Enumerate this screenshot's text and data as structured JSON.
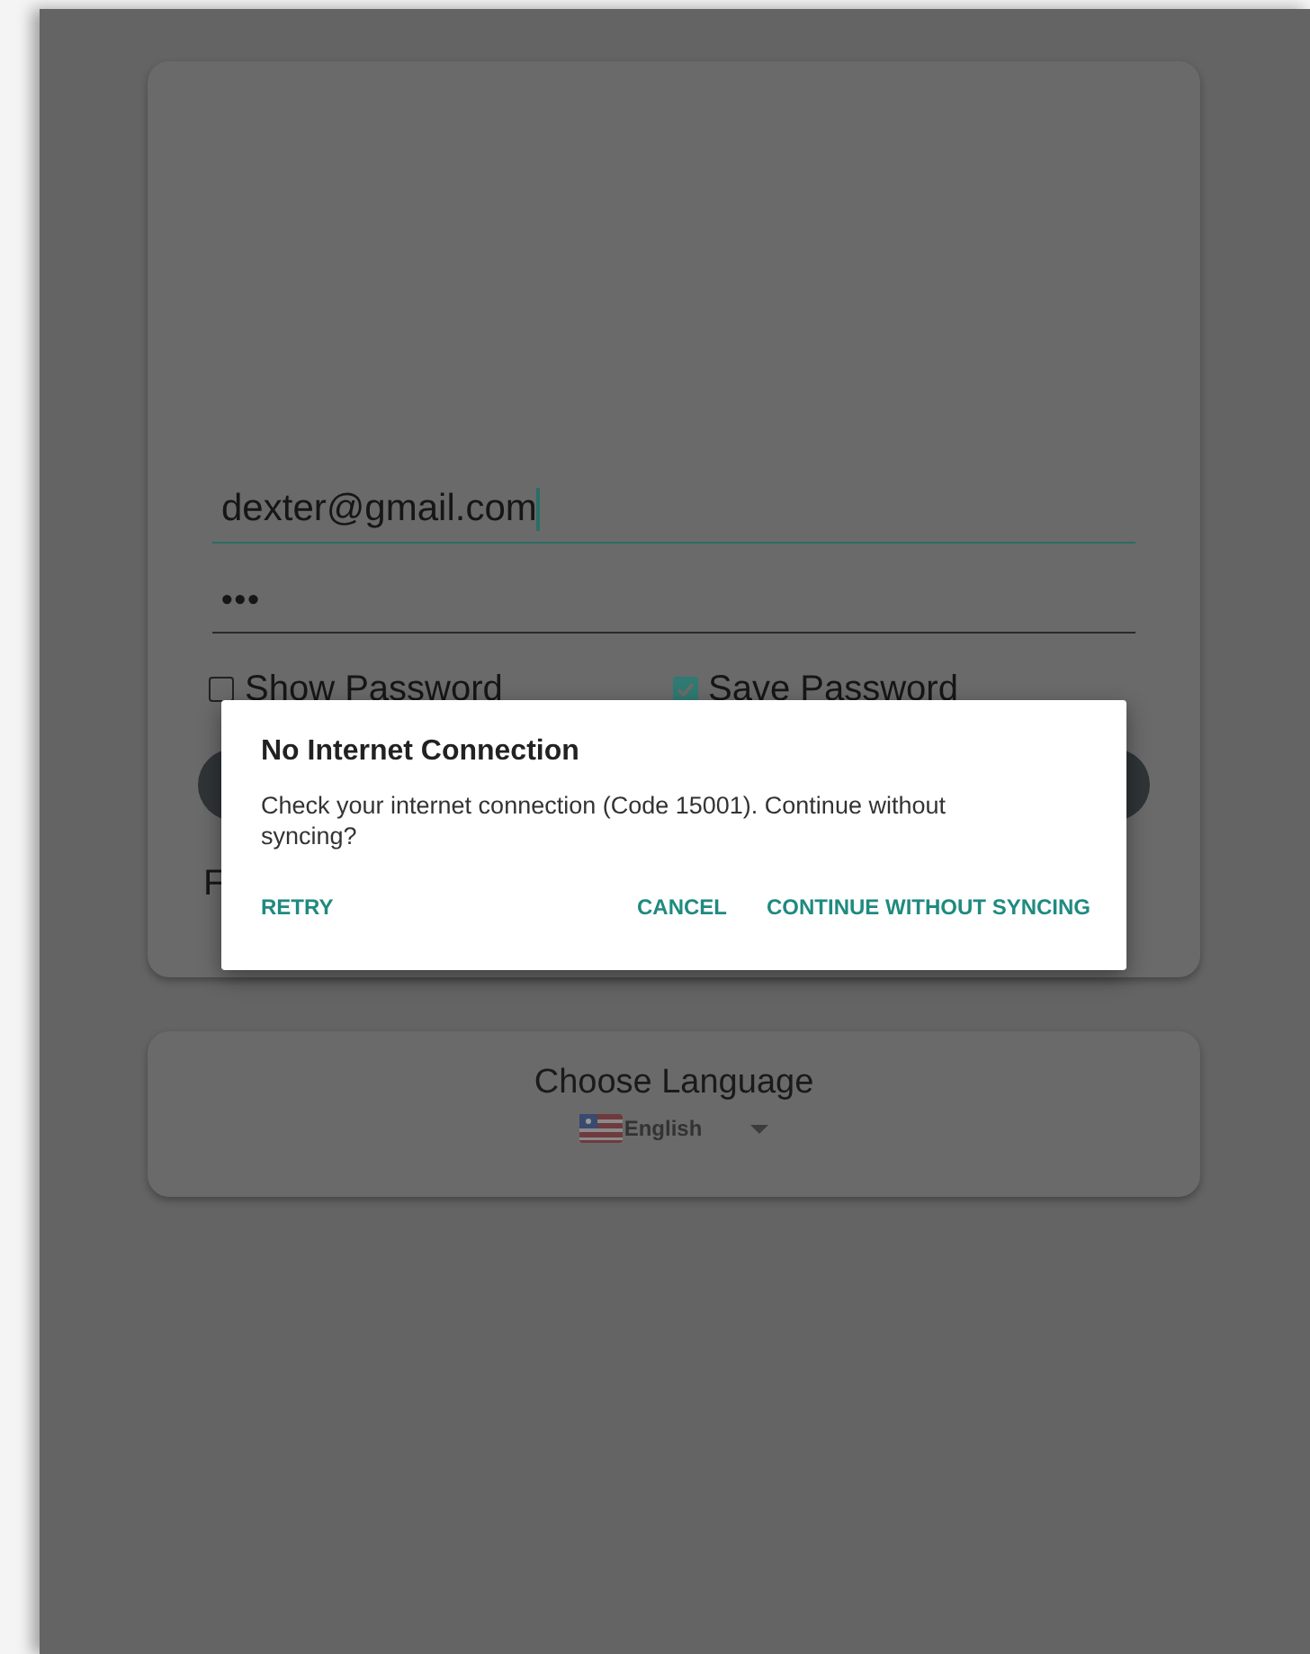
{
  "form": {
    "email": {
      "value": "dexter@gmail.com",
      "focused": true
    },
    "password": {
      "value": "•••"
    },
    "checkboxes": [
      {
        "label": "Show Password",
        "checked": false
      },
      {
        "label": "Save Password",
        "checked": true
      }
    ],
    "link_fragment": "F"
  },
  "language": {
    "title": "Choose Language",
    "selected": "English"
  },
  "dialog": {
    "title": "No Internet Connection",
    "message": "Check your internet connection (Code 15001). Continue without syncing?",
    "buttons": [
      {
        "label": "RETRY"
      },
      {
        "label": "CANCEL"
      },
      {
        "label": "CONTINUE WITHOUT SYNCING"
      }
    ]
  }
}
